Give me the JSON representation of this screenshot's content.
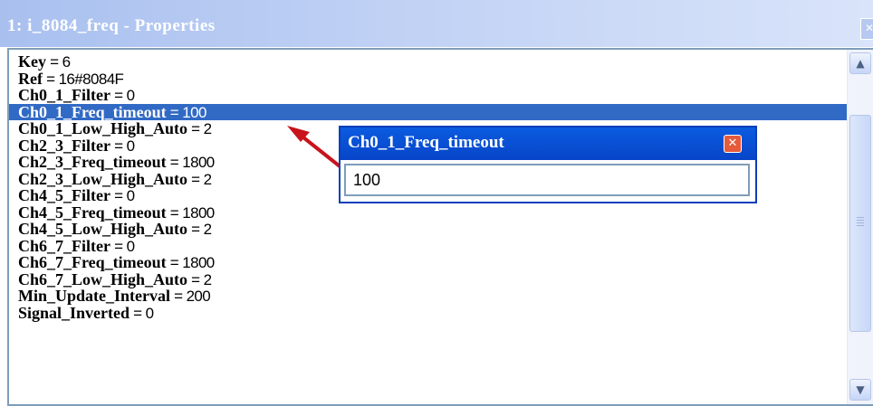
{
  "window": {
    "title": "1: i_8084_freq - Properties",
    "close_icon": "close-icon"
  },
  "properties": [
    {
      "key": "Key",
      "value": "6"
    },
    {
      "key": "Ref",
      "value": "16#8084F"
    },
    {
      "key": "Ch0_1_Filter",
      "value": "0"
    },
    {
      "key": "Ch0_1_Freq_timeout",
      "value": "100",
      "selected": true
    },
    {
      "key": "Ch0_1_Low_High_Auto",
      "value": "2"
    },
    {
      "key": "Ch2_3_Filter",
      "value": "0"
    },
    {
      "key": "Ch2_3_Freq_timeout",
      "value": "1800"
    },
    {
      "key": "Ch2_3_Low_High_Auto",
      "value": "2"
    },
    {
      "key": "Ch4_5_Filter",
      "value": "0"
    },
    {
      "key": "Ch4_5_Freq_timeout",
      "value": "1800"
    },
    {
      "key": "Ch4_5_Low_High_Auto",
      "value": "2"
    },
    {
      "key": "Ch6_7_Filter",
      "value": "0"
    },
    {
      "key": "Ch6_7_Freq_timeout",
      "value": "1800"
    },
    {
      "key": "Ch6_7_Low_High_Auto",
      "value": "2"
    },
    {
      "key": "Min_Update_Interval",
      "value": "200"
    },
    {
      "key": "Signal_Inverted",
      "value": "0"
    }
  ],
  "editor": {
    "title": "Ch0_1_Freq_timeout",
    "value": "100"
  },
  "colors": {
    "selection": "#316ac5",
    "arrow": "#c8141c",
    "popup_title": "#0a5be0"
  }
}
